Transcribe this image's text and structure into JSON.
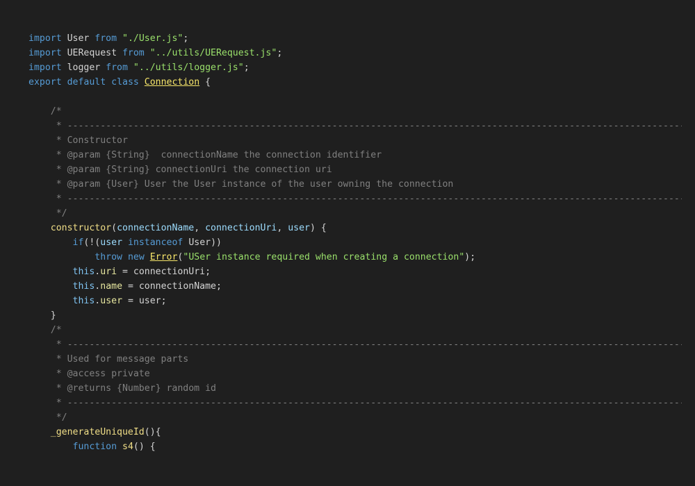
{
  "colors": {
    "background": "#1f1f1f",
    "keyword": "#569cd6",
    "string": "#9ae06b",
    "class_name": "#f7e66a",
    "function_name": "#f0de87",
    "parameter": "#9cdcfe",
    "comment": "#808080",
    "text": "#d4d4d4"
  },
  "code": {
    "lines": [
      [
        [
          "kw",
          "import"
        ],
        [
          "plain",
          " User "
        ],
        [
          "kw",
          "from"
        ],
        [
          "plain",
          " "
        ],
        [
          "str",
          "\"./User.js\""
        ],
        [
          "plain",
          ";"
        ]
      ],
      [
        [
          "kw",
          "import"
        ],
        [
          "plain",
          " UERequest "
        ],
        [
          "kw",
          "from"
        ],
        [
          "plain",
          " "
        ],
        [
          "str",
          "\"../utils/UERequest.js\""
        ],
        [
          "plain",
          ";"
        ]
      ],
      [
        [
          "kw",
          "import"
        ],
        [
          "plain",
          " logger "
        ],
        [
          "kw",
          "from"
        ],
        [
          "plain",
          " "
        ],
        [
          "str",
          "\"../utils/logger.js\""
        ],
        [
          "plain",
          ";"
        ]
      ],
      [
        [
          "kw",
          "export"
        ],
        [
          "plain",
          " "
        ],
        [
          "kw",
          "default"
        ],
        [
          "plain",
          " "
        ],
        [
          "kw",
          "class"
        ],
        [
          "plain",
          " "
        ],
        [
          "cls",
          "Connection"
        ],
        [
          "plain",
          " {"
        ]
      ],
      [
        [
          "plain",
          ""
        ]
      ],
      [
        [
          "com",
          "    /*"
        ]
      ],
      [
        [
          "com",
          "     * ------------------------------------------------------------------------------------------------------------------"
        ]
      ],
      [
        [
          "com",
          "     * Constructor"
        ]
      ],
      [
        [
          "com",
          "     * @param {String}  connectionName the connection identifier"
        ]
      ],
      [
        [
          "com",
          "     * @param {String} connectionUri the connection uri"
        ]
      ],
      [
        [
          "com",
          "     * @param {User} User the User instance of the user owning the connection"
        ]
      ],
      [
        [
          "com",
          "     * ------------------------------------------------------------------------------------------------------------------"
        ]
      ],
      [
        [
          "com",
          "     */"
        ]
      ],
      [
        [
          "plain",
          "    "
        ],
        [
          "fn",
          "constructor"
        ],
        [
          "plain",
          "("
        ],
        [
          "param",
          "connectionName"
        ],
        [
          "plain",
          ", "
        ],
        [
          "param",
          "connectionUri"
        ],
        [
          "plain",
          ", "
        ],
        [
          "param",
          "user"
        ],
        [
          "plain",
          ") {"
        ]
      ],
      [
        [
          "plain",
          "        "
        ],
        [
          "kw",
          "if"
        ],
        [
          "plain",
          "(!("
        ],
        [
          "param",
          "user"
        ],
        [
          "plain",
          " "
        ],
        [
          "kw",
          "instanceof"
        ],
        [
          "plain",
          " User))"
        ]
      ],
      [
        [
          "plain",
          "            "
        ],
        [
          "kw",
          "throw"
        ],
        [
          "plain",
          " "
        ],
        [
          "kw",
          "new"
        ],
        [
          "plain",
          " "
        ],
        [
          "cls",
          "Error"
        ],
        [
          "plain",
          "("
        ],
        [
          "str",
          "\"USer instance required when creating a connection\""
        ],
        [
          "plain",
          ");"
        ]
      ],
      [
        [
          "plain",
          "        "
        ],
        [
          "this",
          "this"
        ],
        [
          "plain",
          "."
        ],
        [
          "prop",
          "uri"
        ],
        [
          "plain",
          " = connectionUri;"
        ]
      ],
      [
        [
          "plain",
          "        "
        ],
        [
          "this",
          "this"
        ],
        [
          "plain",
          "."
        ],
        [
          "prop",
          "name"
        ],
        [
          "plain",
          " = connectionName;"
        ]
      ],
      [
        [
          "plain",
          "        "
        ],
        [
          "this",
          "this"
        ],
        [
          "plain",
          "."
        ],
        [
          "prop",
          "user"
        ],
        [
          "plain",
          " = user;"
        ]
      ],
      [
        [
          "plain",
          "    }"
        ]
      ],
      [
        [
          "com",
          "    /*"
        ]
      ],
      [
        [
          "com",
          "     * ------------------------------------------------------------------------------------------------------------------"
        ]
      ],
      [
        [
          "com",
          "     * Used for message parts"
        ]
      ],
      [
        [
          "com",
          "     * @access private"
        ]
      ],
      [
        [
          "com",
          "     * @returns {Number} random id"
        ]
      ],
      [
        [
          "com",
          "     * ------------------------------------------------------------------------------------------------------------------"
        ]
      ],
      [
        [
          "com",
          "     */"
        ]
      ],
      [
        [
          "plain",
          "    "
        ],
        [
          "fn",
          "_generateUniqueId"
        ],
        [
          "plain",
          "(){"
        ]
      ],
      [
        [
          "plain",
          "        "
        ],
        [
          "kw",
          "function"
        ],
        [
          "plain",
          " "
        ],
        [
          "fn",
          "s4"
        ],
        [
          "plain",
          "() {"
        ]
      ]
    ]
  }
}
